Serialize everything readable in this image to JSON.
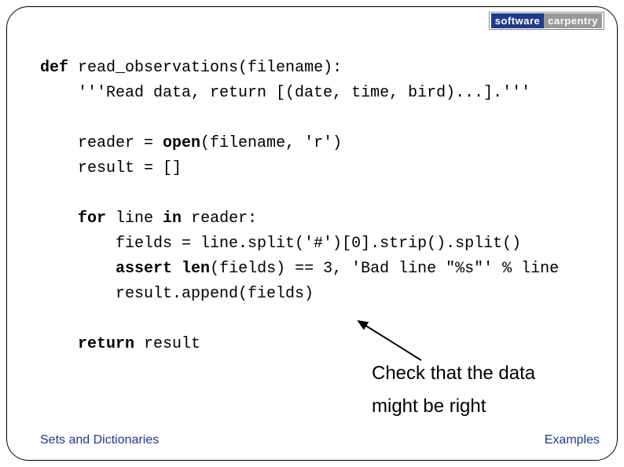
{
  "logo": {
    "part1": "software",
    "part2": "carpentry"
  },
  "code": {
    "l1a": "def",
    "l1b": " read_observations(filename):",
    "l2": "    '''Read data, return [(date, time, bird)...].'''",
    "l3": "",
    "l4a": "    reader = ",
    "l4b": "open",
    "l4c": "(filename, 'r')",
    "l5": "    result = []",
    "l6": "",
    "l7a": "    ",
    "l7b": "for",
    "l7c": " line ",
    "l7d": "in",
    "l7e": " reader:",
    "l8": "        fields = line.split('#')[0].strip().split()",
    "l9a": "        ",
    "l9b": "assert",
    "l9c": " ",
    "l9d": "len",
    "l9e": "(fields) == 3, 'Bad line \"%s\"' % line",
    "l10": "        result.append(fields)",
    "l11": "",
    "l12a": "    ",
    "l12b": "return",
    "l12c": " result"
  },
  "annotation": {
    "line1": "Check that the data",
    "line2": "might be right"
  },
  "footer": {
    "left": "Sets and Dictionaries",
    "right": "Examples"
  }
}
